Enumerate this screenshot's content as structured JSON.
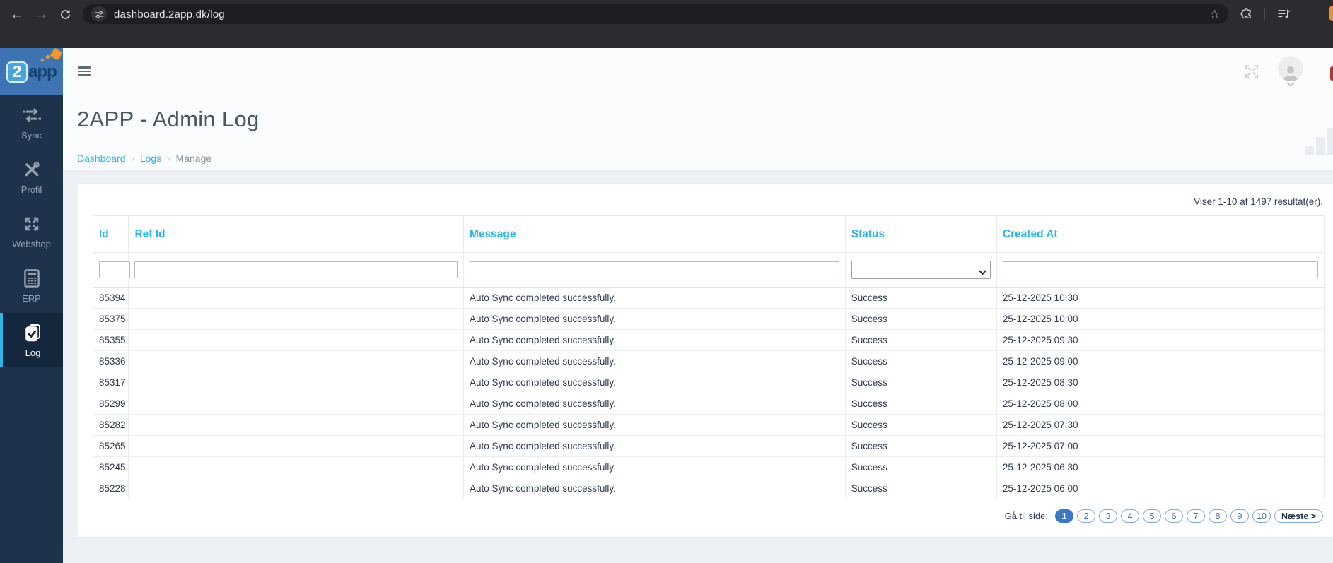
{
  "browser": {
    "url": "dashboard.2app.dk/log",
    "icons": [
      "back-arrow",
      "forward-arrow",
      "refresh",
      "site-settings",
      "bookmark-star",
      "extensions",
      "media-queue"
    ]
  },
  "sidebar": {
    "logo": {
      "part1": "2",
      "part2": "app"
    },
    "items": [
      {
        "label": "Sync",
        "icon": "sync-arrows-icon",
        "active": false
      },
      {
        "label": "Profil",
        "icon": "tools-icon",
        "active": false
      },
      {
        "label": "Webshop",
        "icon": "webshop-icon",
        "active": false
      },
      {
        "label": "ERP",
        "icon": "calculator-icon",
        "active": false
      },
      {
        "label": "Log",
        "icon": "log-check-icon",
        "active": true
      }
    ]
  },
  "topbar": {
    "icons": [
      "menu-hamburger",
      "fullscreen-toggle",
      "user-avatar",
      "chevron-down"
    ]
  },
  "page": {
    "title": "2APP - Admin Log",
    "breadcrumb": {
      "separator": "›",
      "items": [
        {
          "label": "Dashboard",
          "link": true
        },
        {
          "label": "Logs",
          "link": true
        },
        {
          "label": "Manage",
          "link": false
        }
      ]
    }
  },
  "results_summary": "Viser 1-10 af 1497 resultat(er).",
  "table": {
    "columns": [
      "Id",
      "Ref Id",
      "Message",
      "Status",
      "Created At"
    ],
    "filters": {
      "id_value": "",
      "ref_id_value": "",
      "message_value": "",
      "status_selected": "",
      "created_at_value": ""
    },
    "rows": [
      {
        "id": "85394",
        "ref_id": "",
        "message": "Auto Sync completed successfully.",
        "status": "Success",
        "created_at": "25-12-2025 10:30"
      },
      {
        "id": "85375",
        "ref_id": "",
        "message": "Auto Sync completed successfully.",
        "status": "Success",
        "created_at": "25-12-2025 10:00"
      },
      {
        "id": "85355",
        "ref_id": "",
        "message": "Auto Sync completed successfully.",
        "status": "Success",
        "created_at": "25-12-2025 09:30"
      },
      {
        "id": "85336",
        "ref_id": "",
        "message": "Auto Sync completed successfully.",
        "status": "Success",
        "created_at": "25-12-2025 09:00"
      },
      {
        "id": "85317",
        "ref_id": "",
        "message": "Auto Sync completed successfully.",
        "status": "Success",
        "created_at": "25-12-2025 08:30"
      },
      {
        "id": "85299",
        "ref_id": "",
        "message": "Auto Sync completed successfully.",
        "status": "Success",
        "created_at": "25-12-2025 08:00"
      },
      {
        "id": "85282",
        "ref_id": "",
        "message": "Auto Sync completed successfully.",
        "status": "Success",
        "created_at": "25-12-2025 07:30"
      },
      {
        "id": "85265",
        "ref_id": "",
        "message": "Auto Sync completed successfully.",
        "status": "Success",
        "created_at": "25-12-2025 07:00"
      },
      {
        "id": "85245",
        "ref_id": "",
        "message": "Auto Sync completed successfully.",
        "status": "Success",
        "created_at": "25-12-2025 06:30"
      },
      {
        "id": "85228",
        "ref_id": "",
        "message": "Auto Sync completed successfully.",
        "status": "Success",
        "created_at": "25-12-2025 06:00"
      }
    ]
  },
  "pagination": {
    "label": "Gå til side:",
    "pages": [
      "1",
      "2",
      "3",
      "4",
      "5",
      "6",
      "7",
      "8",
      "9",
      "10"
    ],
    "active_page": "1",
    "next_label": "Næste >"
  },
  "colors": {
    "accent_cyan": "#2bb5e8",
    "sidebar_bg": "#1e334b",
    "sidebar_active_bg": "#15273c",
    "logo_bg": "#3e74b3",
    "logo_orange": "#ef9a28",
    "content_bg": "#edf0f5",
    "text_navy": "#2e3b55",
    "pagination_active": "#3a79c4",
    "chrome_bg": "#2c2b30"
  }
}
